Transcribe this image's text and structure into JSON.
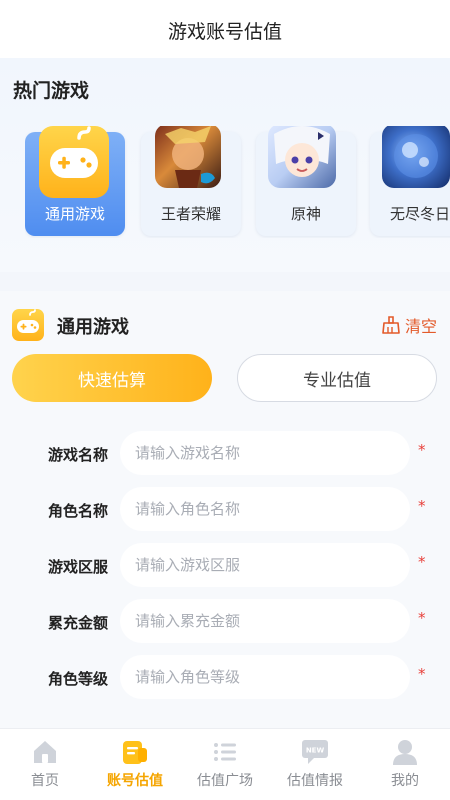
{
  "header": {
    "title": "游戏账号估值"
  },
  "hot_games": {
    "title": "热门游戏",
    "items": [
      {
        "label": "通用游戏",
        "active": true,
        "icon": "gamepad-icon"
      },
      {
        "label": "王者荣耀",
        "active": false,
        "icon": "wzry-thumbnail"
      },
      {
        "label": "原神",
        "active": false,
        "icon": "genshin-thumbnail"
      },
      {
        "label": "无尽冬日",
        "active": false,
        "icon": "whiteout-thumbnail"
      }
    ]
  },
  "form": {
    "title": "通用游戏",
    "clear_label": "清空",
    "tabs": {
      "quick": "快速估算",
      "pro": "专业估值"
    },
    "fields": [
      {
        "label": "游戏名称",
        "placeholder": "请输入游戏名称",
        "value": "",
        "required": "*"
      },
      {
        "label": "角色名称",
        "placeholder": "请输入角色名称",
        "value": "",
        "required": "*"
      },
      {
        "label": "游戏区服",
        "placeholder": "请输入游戏区服",
        "value": "",
        "required": "*"
      },
      {
        "label": "累充金额",
        "placeholder": "请输入累充金额",
        "value": "",
        "required": "*"
      },
      {
        "label": "角色等级",
        "placeholder": "请输入角色等级",
        "value": "",
        "required": "*"
      }
    ]
  },
  "nav": {
    "items": [
      {
        "label": "首页",
        "icon": "home-icon",
        "active": false
      },
      {
        "label": "账号估值",
        "icon": "valuation-icon",
        "active": true
      },
      {
        "label": "估值广场",
        "icon": "list-icon",
        "active": false
      },
      {
        "label": "估值情报",
        "icon": "news-icon",
        "active": false
      },
      {
        "label": "我的",
        "icon": "user-icon",
        "active": false
      }
    ]
  },
  "colors": {
    "accent": "#ffb21a",
    "active_card": "#4f8df0",
    "required": "#e8413b",
    "clear": "#e35a2a"
  }
}
